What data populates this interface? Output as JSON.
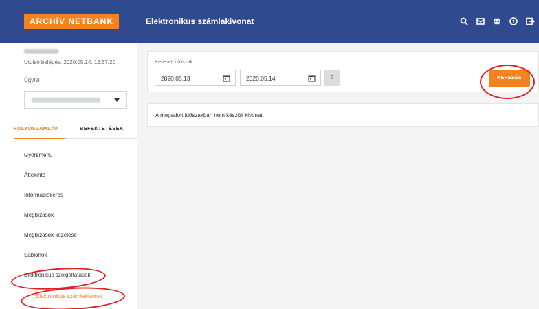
{
  "header": {
    "logo": "ARCHÍV NETBANK",
    "title": "Elektronikus számlakivonat",
    "icons": [
      "search-icon",
      "mail-icon",
      "globe-icon",
      "help-icon",
      "logout-icon"
    ]
  },
  "sidebar": {
    "last_login": "Utolsó belépés: 2020.05.14. 12:57:20",
    "client_label": "Ügyfél",
    "tabs": [
      {
        "label": "FOLYÓSZÁMLÁK",
        "active": true
      },
      {
        "label": "BEFEKTETÉSEK",
        "active": false
      }
    ],
    "items": [
      {
        "label": "Gyorsmenü"
      },
      {
        "label": "Áttekintő"
      },
      {
        "label": "Információkérés"
      },
      {
        "label": "Megbízások"
      },
      {
        "label": "Megbízások kezelése"
      },
      {
        "label": "Sablonok"
      },
      {
        "label": "Elektronikus szolgáltatások"
      }
    ],
    "sub_item": "Elektronikus számlakivonat"
  },
  "main": {
    "period_label": "Keresett időszak:",
    "date_from": "2020.05.13",
    "date_to": "2020.05.14",
    "help_label": "?",
    "search_label": "KERESÉS",
    "result_text": "A megadott időszakban nem készült kivonat."
  },
  "colors": {
    "header_bg": "#2f4a8f",
    "accent": "#f5821f",
    "annotation": "#e02020"
  }
}
